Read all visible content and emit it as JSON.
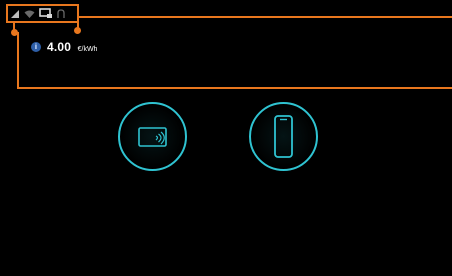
{
  "status_bar": {
    "icons": [
      "signal-icon",
      "wifi-icon",
      "display-icon",
      "card-reader-icon"
    ]
  },
  "price": {
    "info_icon": "i",
    "value": "4.00",
    "unit": "€/kWh"
  },
  "payment_options": [
    {
      "name": "card-payment-option",
      "icon": "contactless-card-icon"
    },
    {
      "name": "phone-payment-option",
      "icon": "smartphone-icon"
    }
  ],
  "colors": {
    "background": "#000000",
    "accent_ring": "#2fc3d1",
    "callout": "#e8771e",
    "info_badge": "#2e5fa8"
  }
}
